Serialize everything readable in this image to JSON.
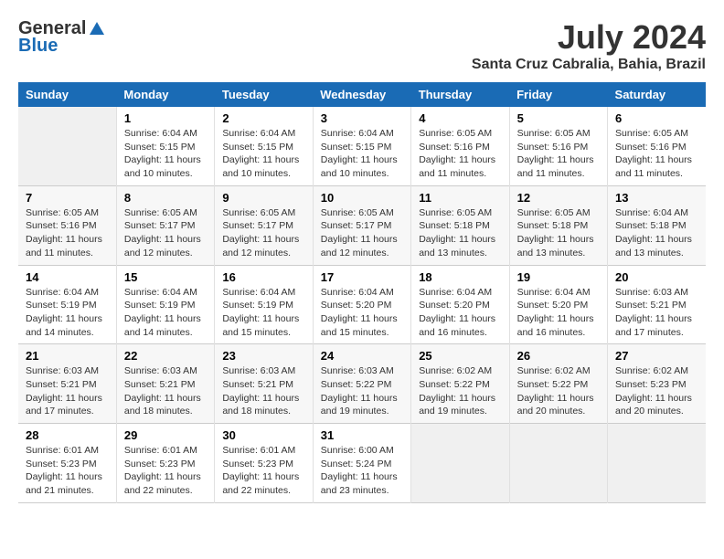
{
  "header": {
    "logo_general": "General",
    "logo_blue": "Blue",
    "month_year": "July 2024",
    "location": "Santa Cruz Cabralia, Bahia, Brazil"
  },
  "calendar": {
    "days_of_week": [
      "Sunday",
      "Monday",
      "Tuesday",
      "Wednesday",
      "Thursday",
      "Friday",
      "Saturday"
    ],
    "weeks": [
      [
        {
          "day": "",
          "info": ""
        },
        {
          "day": "1",
          "info": "Sunrise: 6:04 AM\nSunset: 5:15 PM\nDaylight: 11 hours\nand 10 minutes."
        },
        {
          "day": "2",
          "info": "Sunrise: 6:04 AM\nSunset: 5:15 PM\nDaylight: 11 hours\nand 10 minutes."
        },
        {
          "day": "3",
          "info": "Sunrise: 6:04 AM\nSunset: 5:15 PM\nDaylight: 11 hours\nand 10 minutes."
        },
        {
          "day": "4",
          "info": "Sunrise: 6:05 AM\nSunset: 5:16 PM\nDaylight: 11 hours\nand 11 minutes."
        },
        {
          "day": "5",
          "info": "Sunrise: 6:05 AM\nSunset: 5:16 PM\nDaylight: 11 hours\nand 11 minutes."
        },
        {
          "day": "6",
          "info": "Sunrise: 6:05 AM\nSunset: 5:16 PM\nDaylight: 11 hours\nand 11 minutes."
        }
      ],
      [
        {
          "day": "7",
          "info": "Sunrise: 6:05 AM\nSunset: 5:16 PM\nDaylight: 11 hours\nand 11 minutes."
        },
        {
          "day": "8",
          "info": "Sunrise: 6:05 AM\nSunset: 5:17 PM\nDaylight: 11 hours\nand 12 minutes."
        },
        {
          "day": "9",
          "info": "Sunrise: 6:05 AM\nSunset: 5:17 PM\nDaylight: 11 hours\nand 12 minutes."
        },
        {
          "day": "10",
          "info": "Sunrise: 6:05 AM\nSunset: 5:17 PM\nDaylight: 11 hours\nand 12 minutes."
        },
        {
          "day": "11",
          "info": "Sunrise: 6:05 AM\nSunset: 5:18 PM\nDaylight: 11 hours\nand 13 minutes."
        },
        {
          "day": "12",
          "info": "Sunrise: 6:05 AM\nSunset: 5:18 PM\nDaylight: 11 hours\nand 13 minutes."
        },
        {
          "day": "13",
          "info": "Sunrise: 6:04 AM\nSunset: 5:18 PM\nDaylight: 11 hours\nand 13 minutes."
        }
      ],
      [
        {
          "day": "14",
          "info": "Sunrise: 6:04 AM\nSunset: 5:19 PM\nDaylight: 11 hours\nand 14 minutes."
        },
        {
          "day": "15",
          "info": "Sunrise: 6:04 AM\nSunset: 5:19 PM\nDaylight: 11 hours\nand 14 minutes."
        },
        {
          "day": "16",
          "info": "Sunrise: 6:04 AM\nSunset: 5:19 PM\nDaylight: 11 hours\nand 15 minutes."
        },
        {
          "day": "17",
          "info": "Sunrise: 6:04 AM\nSunset: 5:20 PM\nDaylight: 11 hours\nand 15 minutes."
        },
        {
          "day": "18",
          "info": "Sunrise: 6:04 AM\nSunset: 5:20 PM\nDaylight: 11 hours\nand 16 minutes."
        },
        {
          "day": "19",
          "info": "Sunrise: 6:04 AM\nSunset: 5:20 PM\nDaylight: 11 hours\nand 16 minutes."
        },
        {
          "day": "20",
          "info": "Sunrise: 6:03 AM\nSunset: 5:21 PM\nDaylight: 11 hours\nand 17 minutes."
        }
      ],
      [
        {
          "day": "21",
          "info": "Sunrise: 6:03 AM\nSunset: 5:21 PM\nDaylight: 11 hours\nand 17 minutes."
        },
        {
          "day": "22",
          "info": "Sunrise: 6:03 AM\nSunset: 5:21 PM\nDaylight: 11 hours\nand 18 minutes."
        },
        {
          "day": "23",
          "info": "Sunrise: 6:03 AM\nSunset: 5:21 PM\nDaylight: 11 hours\nand 18 minutes."
        },
        {
          "day": "24",
          "info": "Sunrise: 6:03 AM\nSunset: 5:22 PM\nDaylight: 11 hours\nand 19 minutes."
        },
        {
          "day": "25",
          "info": "Sunrise: 6:02 AM\nSunset: 5:22 PM\nDaylight: 11 hours\nand 19 minutes."
        },
        {
          "day": "26",
          "info": "Sunrise: 6:02 AM\nSunset: 5:22 PM\nDaylight: 11 hours\nand 20 minutes."
        },
        {
          "day": "27",
          "info": "Sunrise: 6:02 AM\nSunset: 5:23 PM\nDaylight: 11 hours\nand 20 minutes."
        }
      ],
      [
        {
          "day": "28",
          "info": "Sunrise: 6:01 AM\nSunset: 5:23 PM\nDaylight: 11 hours\nand 21 minutes."
        },
        {
          "day": "29",
          "info": "Sunrise: 6:01 AM\nSunset: 5:23 PM\nDaylight: 11 hours\nand 22 minutes."
        },
        {
          "day": "30",
          "info": "Sunrise: 6:01 AM\nSunset: 5:23 PM\nDaylight: 11 hours\nand 22 minutes."
        },
        {
          "day": "31",
          "info": "Sunrise: 6:00 AM\nSunset: 5:24 PM\nDaylight: 11 hours\nand 23 minutes."
        },
        {
          "day": "",
          "info": ""
        },
        {
          "day": "",
          "info": ""
        },
        {
          "day": "",
          "info": ""
        }
      ]
    ]
  }
}
